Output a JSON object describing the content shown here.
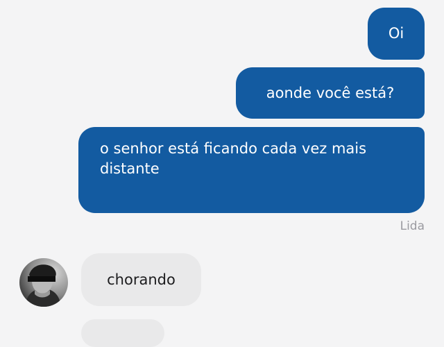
{
  "conversation": {
    "messages": [
      {
        "direction": "sent",
        "text": "Oi"
      },
      {
        "direction": "sent",
        "text": "aonde você está?"
      },
      {
        "direction": "sent",
        "text": "o senhor está ficando cada vez mais distante"
      },
      {
        "direction": "received",
        "text": "chorando"
      },
      {
        "direction": "received",
        "text": ""
      }
    ],
    "read_status": "Lida"
  },
  "colors": {
    "background": "#f4f4f5",
    "sent_bubble": "#135ba1",
    "sent_text": "#ffffff",
    "received_bubble": "#e9e9ea",
    "received_text": "#1c1c1e",
    "status_text": "#9a9aa0"
  },
  "icons": {
    "avatar": "contact-avatar-photo"
  }
}
